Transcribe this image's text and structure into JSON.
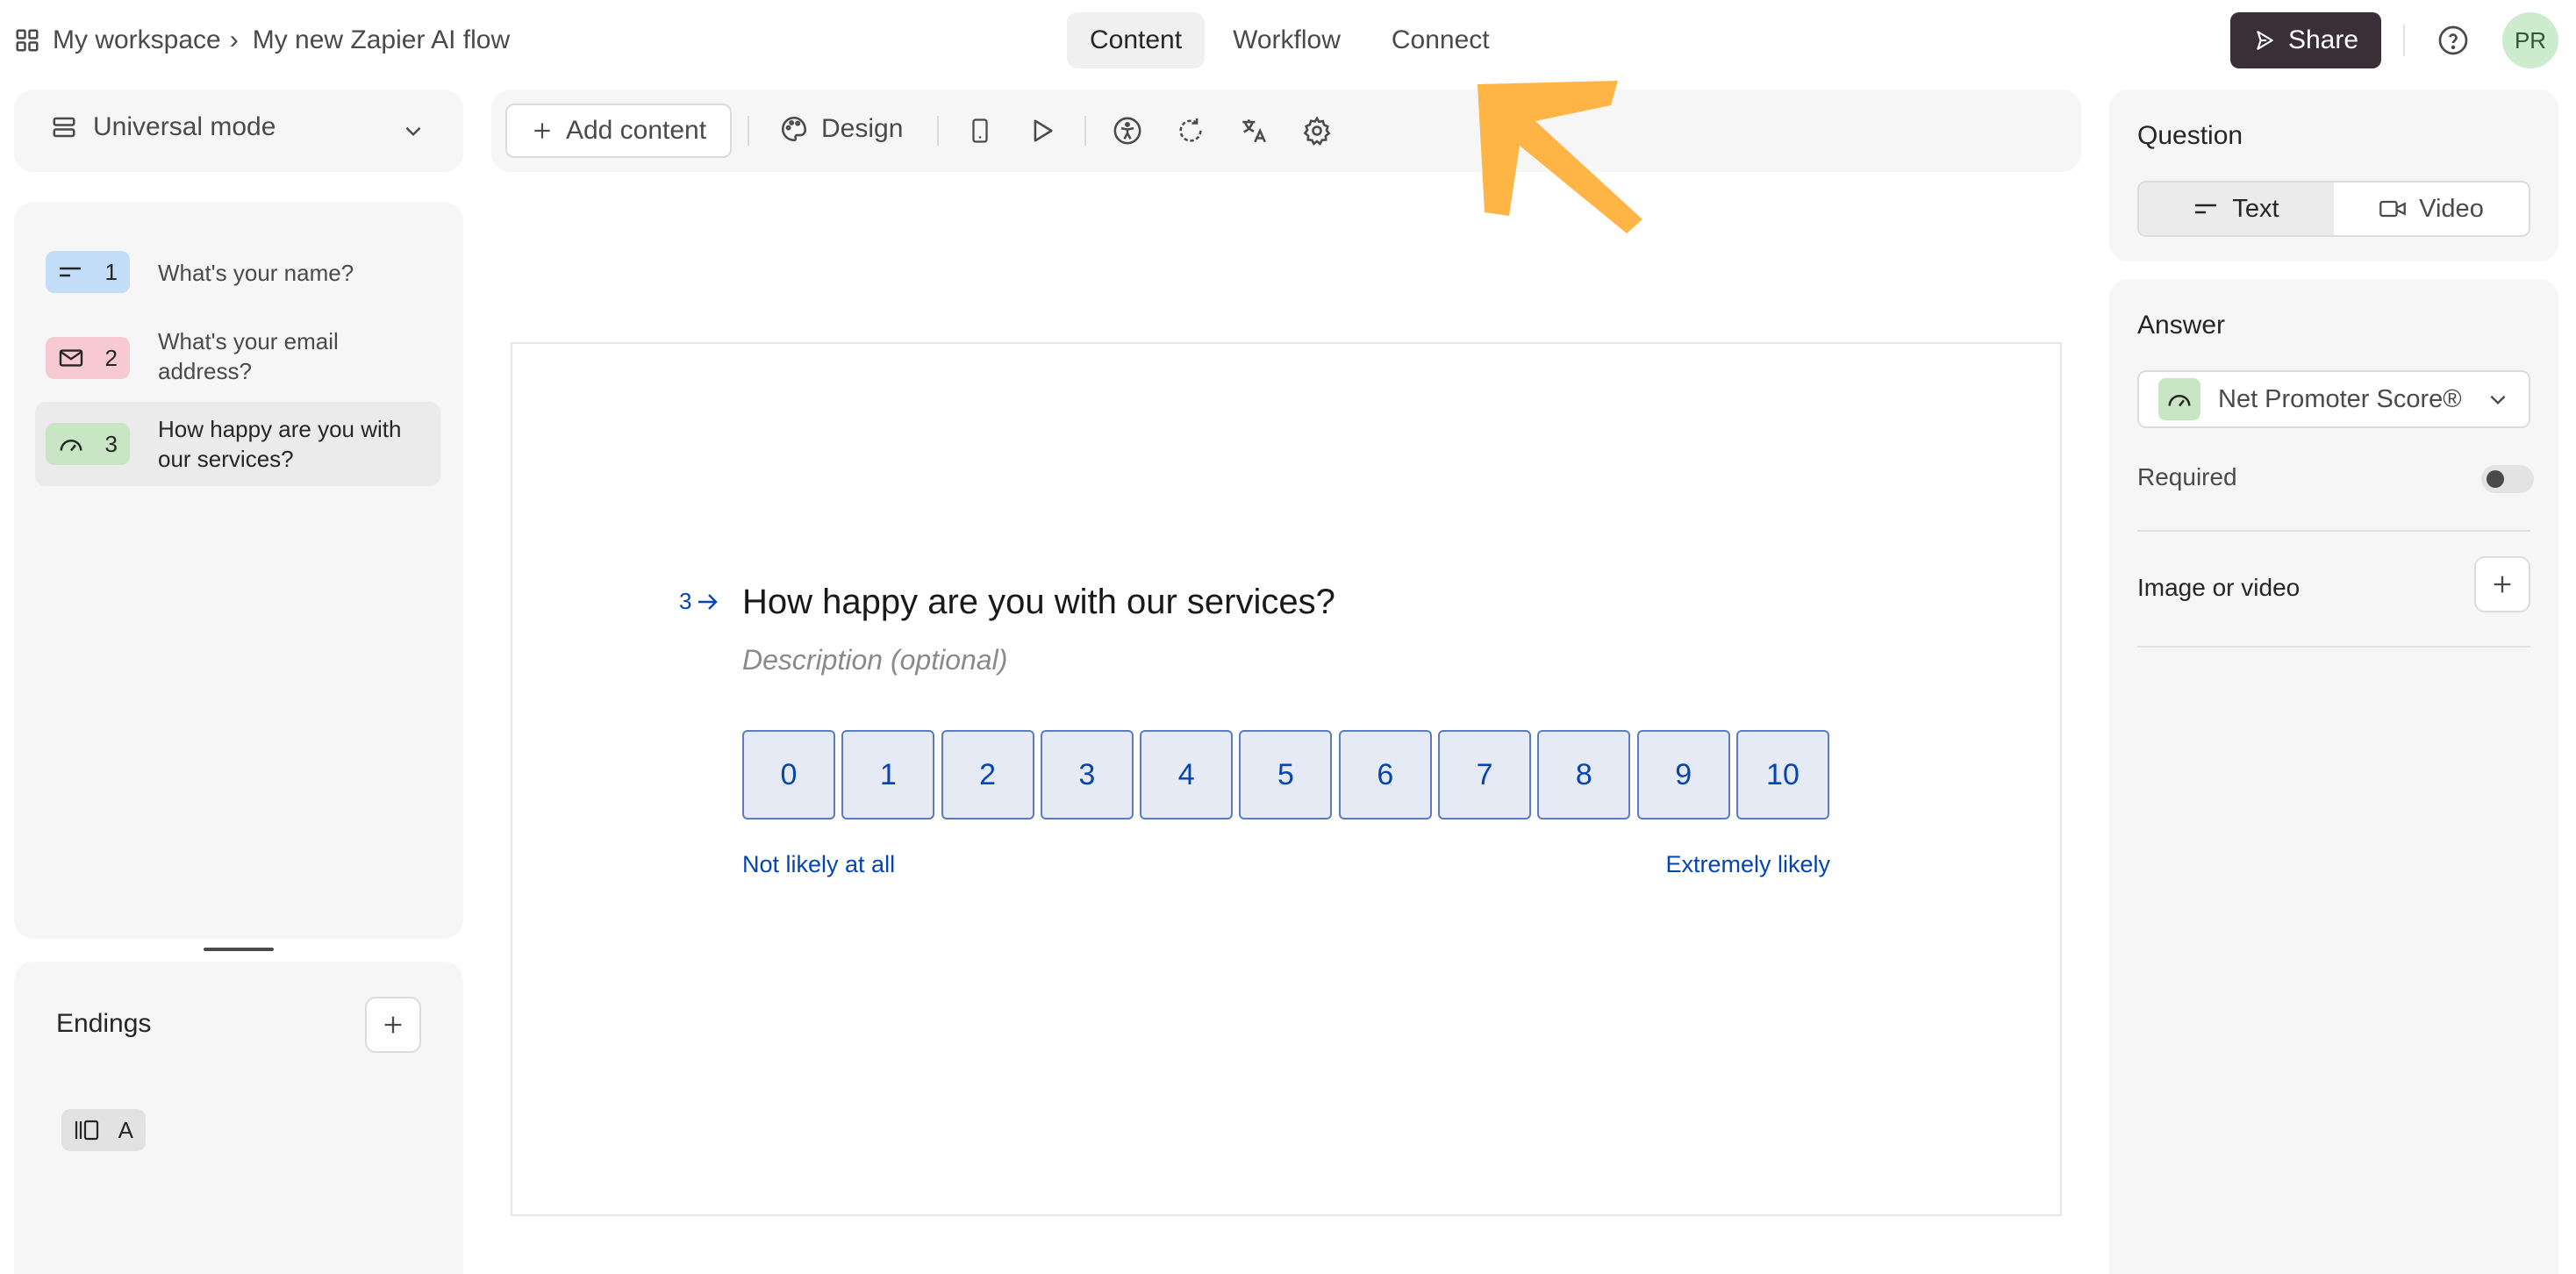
{
  "breadcrumb": {
    "workspace": "My workspace",
    "separator": "›",
    "form": "My new Zapier AI flow"
  },
  "tabs": [
    {
      "label": "Content",
      "active": true
    },
    {
      "label": "Workflow",
      "active": false
    },
    {
      "label": "Connect",
      "active": false
    }
  ],
  "header": {
    "share_label": "Share",
    "avatar_initials": "PR",
    "share_color": "#3a2f36",
    "help_icon": "help-circle-icon"
  },
  "mode": {
    "label": "Universal mode"
  },
  "questions": [
    {
      "number": "1",
      "text": "What's your name?",
      "icon": "short-text-icon",
      "color": "#c3dcf7",
      "selected": false
    },
    {
      "number": "2",
      "text": "What's your email address?",
      "icon": "mail-icon",
      "color": "#f7c9d3",
      "selected": false
    },
    {
      "number": "3",
      "text": "How happy are you with our services?",
      "icon": "gauge-icon",
      "color": "#c8e6c4",
      "selected": true
    }
  ],
  "endings": {
    "title": "Endings",
    "items": [
      {
        "label": "A",
        "icon": "ending-icon"
      }
    ]
  },
  "toolbar": {
    "add_content_label": "Add content",
    "design_label": "Design"
  },
  "canvas": {
    "question_number": "3",
    "question_title": "How happy are you with our services?",
    "description_placeholder": "Description (optional)",
    "nps_options": [
      "0",
      "1",
      "2",
      "3",
      "4",
      "5",
      "6",
      "7",
      "8",
      "9",
      "10"
    ],
    "label_left": "Not likely at all",
    "label_right": "Extremely likely",
    "accent": "#0445af"
  },
  "right_panel": {
    "question_title": "Question",
    "question_types": [
      {
        "label": "Text",
        "active": true
      },
      {
        "label": "Video",
        "active": false
      }
    ],
    "answer_title": "Answer",
    "answer_type": "Net Promoter Score®",
    "required_label": "Required",
    "required_on": false,
    "media_label": "Image or video"
  },
  "annotation": {
    "arrow_color": "#ffb545"
  }
}
